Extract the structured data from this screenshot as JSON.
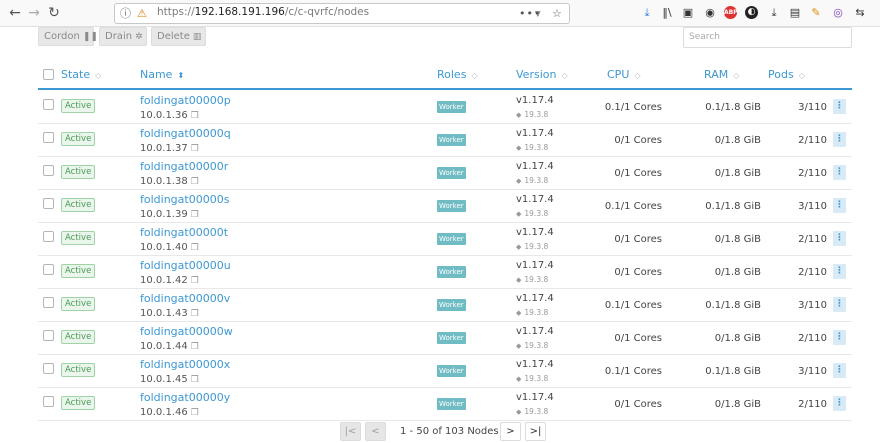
{
  "browser": {
    "url_scheme": "https://",
    "url_host": "192.168.191.196",
    "url_path": "/c/c-qvrfc/nodes",
    "more_icon": "•••",
    "pocket_icon": "pocket-icon",
    "star_icon": "☆"
  },
  "actions": {
    "cordon": "Cordon",
    "drain": "Drain",
    "delete": "Delete",
    "search_placeholder": "Search"
  },
  "columns": {
    "state": "State",
    "name": "Name",
    "roles": "Roles",
    "version": "Version",
    "cpu": "CPU",
    "ram": "RAM",
    "pods": "Pods"
  },
  "rows": [
    {
      "state": "Active",
      "name": "foldingat00000p",
      "ip": "10.0.1.36",
      "role": "Worker",
      "version": "v1.17.4",
      "docker": "19.3.8",
      "cpu": "0.1/1 Cores",
      "ram": "0.1/1.8 GiB",
      "pods": "3/110"
    },
    {
      "state": "Active",
      "name": "foldingat00000q",
      "ip": "10.0.1.37",
      "role": "Worker",
      "version": "v1.17.4",
      "docker": "19.3.8",
      "cpu": "0/1 Cores",
      "ram": "0/1.8 GiB",
      "pods": "2/110"
    },
    {
      "state": "Active",
      "name": "foldingat00000r",
      "ip": "10.0.1.38",
      "role": "Worker",
      "version": "v1.17.4",
      "docker": "19.3.8",
      "cpu": "0/1 Cores",
      "ram": "0/1.8 GiB",
      "pods": "2/110"
    },
    {
      "state": "Active",
      "name": "foldingat00000s",
      "ip": "10.0.1.39",
      "role": "Worker",
      "version": "v1.17.4",
      "docker": "19.3.8",
      "cpu": "0.1/1 Cores",
      "ram": "0.1/1.8 GiB",
      "pods": "3/110"
    },
    {
      "state": "Active",
      "name": "foldingat00000t",
      "ip": "10.0.1.40",
      "role": "Worker",
      "version": "v1.17.4",
      "docker": "19.3.8",
      "cpu": "0/1 Cores",
      "ram": "0/1.8 GiB",
      "pods": "2/110"
    },
    {
      "state": "Active",
      "name": "foldingat00000u",
      "ip": "10.0.1.42",
      "role": "Worker",
      "version": "v1.17.4",
      "docker": "19.3.8",
      "cpu": "0/1 Cores",
      "ram": "0/1.8 GiB",
      "pods": "2/110"
    },
    {
      "state": "Active",
      "name": "foldingat00000v",
      "ip": "10.0.1.43",
      "role": "Worker",
      "version": "v1.17.4",
      "docker": "19.3.8",
      "cpu": "0.1/1 Cores",
      "ram": "0.1/1.8 GiB",
      "pods": "3/110"
    },
    {
      "state": "Active",
      "name": "foldingat00000w",
      "ip": "10.0.1.44",
      "role": "Worker",
      "version": "v1.17.4",
      "docker": "19.3.8",
      "cpu": "0/1 Cores",
      "ram": "0/1.8 GiB",
      "pods": "2/110"
    },
    {
      "state": "Active",
      "name": "foldingat00000x",
      "ip": "10.0.1.45",
      "role": "Worker",
      "version": "v1.17.4",
      "docker": "19.3.8",
      "cpu": "0.1/1 Cores",
      "ram": "0.1/1.8 GiB",
      "pods": "3/110"
    },
    {
      "state": "Active",
      "name": "foldingat00000y",
      "ip": "10.0.1.46",
      "role": "Worker",
      "version": "v1.17.4",
      "docker": "19.3.8",
      "cpu": "0/1 Cores",
      "ram": "0/1.8 GiB",
      "pods": "2/110"
    }
  ],
  "pagination": {
    "info": "1 - 50 of 103 Nodes",
    "first": "|<",
    "prev": "<",
    "next": ">",
    "last": ">|"
  }
}
